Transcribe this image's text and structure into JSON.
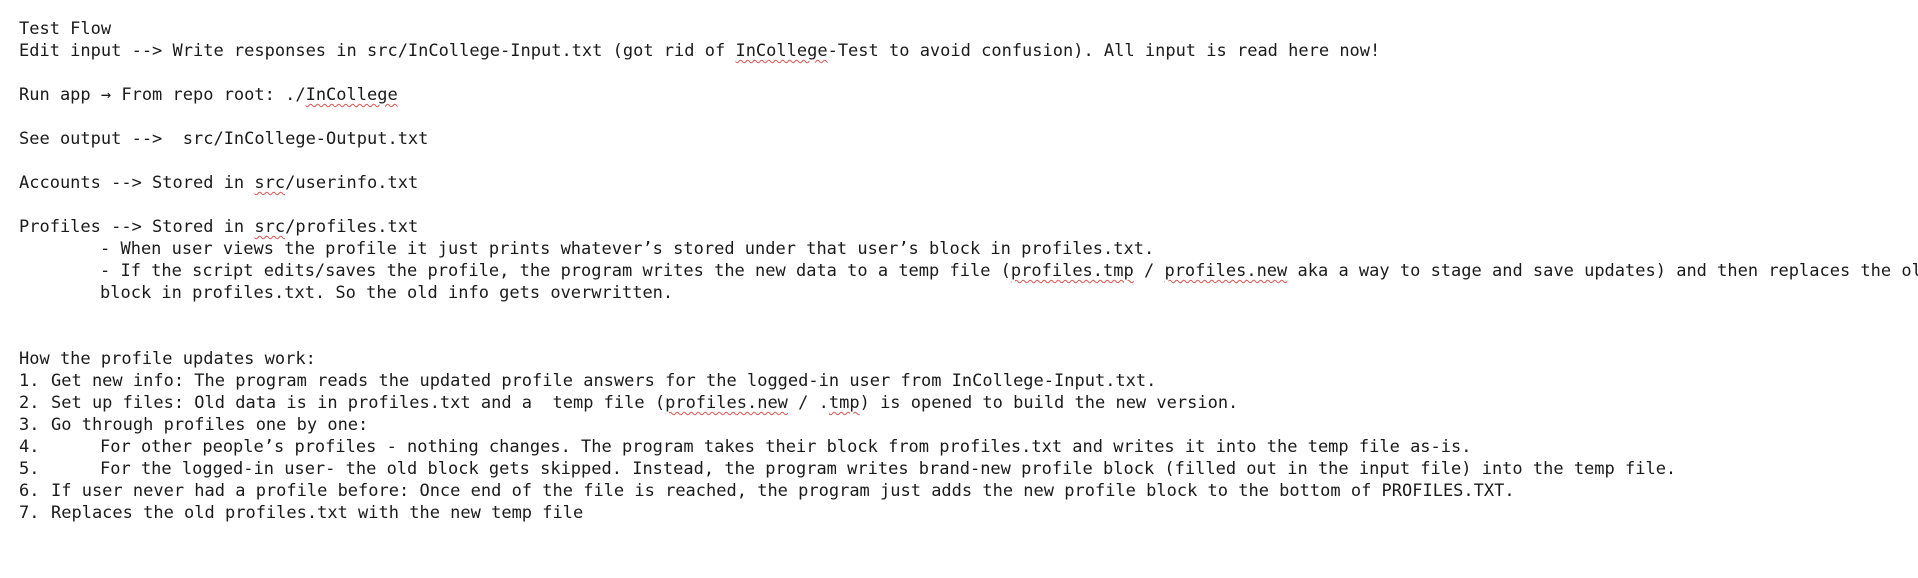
{
  "doc": {
    "title": "Test Flow",
    "edit_input": {
      "a": "Edit input --> Write responses in src/InCollege-Input.txt (got rid of ",
      "b": "InCollege",
      "c": "-Test to avoid confusion). All input is read here now!"
    },
    "run_app": {
      "a": "Run app → From repo root: ./",
      "b": "InCollege"
    },
    "see_output": "See output -->  src/InCollege-Output.txt",
    "accounts": {
      "a": "Accounts --> Stored in ",
      "b": "src",
      "c": "/userinfo.txt"
    },
    "profiles": {
      "a": "Profiles --> Stored in ",
      "b": "src",
      "c": "/profiles.txt"
    },
    "profile_bullets": {
      "view": "- When user views the profile it just prints whatever’s stored under that user’s block in profiles.txt.",
      "edit_a": "- If the script edits/saves the profile, the program writes the new data to a temp file (",
      "edit_b": "profiles.tmp",
      "edit_c": " / ",
      "edit_d": "profiles.new",
      "edit_e": " aka a way to stage and save updates) and then replaces the old",
      "edit_cont": "block in profiles.txt. So the old info gets overwritten."
    },
    "updates_heading": "How the profile updates work:",
    "steps": {
      "s1_num": "1.",
      "s1": "Get new info: The program reads the updated profile answers for the logged-in user from InCollege-Input.txt.",
      "s2_num": "2.",
      "s2_a": "Set up files: Old data is in profiles.txt and a  temp file (",
      "s2_b": "profiles.new",
      "s2_c": " / .",
      "s2_d": "tmp",
      "s2_e": ") is opened to build the new version.",
      "s3_num": "3.",
      "s3": "Go through profiles one by one:",
      "s4_num": "4.",
      "s4": "For other people’s profiles - nothing changes. The program takes their block from profiles.txt and writes it into the temp file as-is.",
      "s5_num": "5.",
      "s5": "For the logged-in user- the old block gets skipped. Instead, the program writes brand-new profile block (filled out in the input file) into the temp file.",
      "s6_num": "6.",
      "s6": "If user never had a profile before: Once end of the file is reached, the program just adds the new profile block to the bottom of PROFILES.TXT.",
      "s7_num": "7.",
      "s7": "Replaces the old profiles.txt with the new temp file"
    }
  }
}
